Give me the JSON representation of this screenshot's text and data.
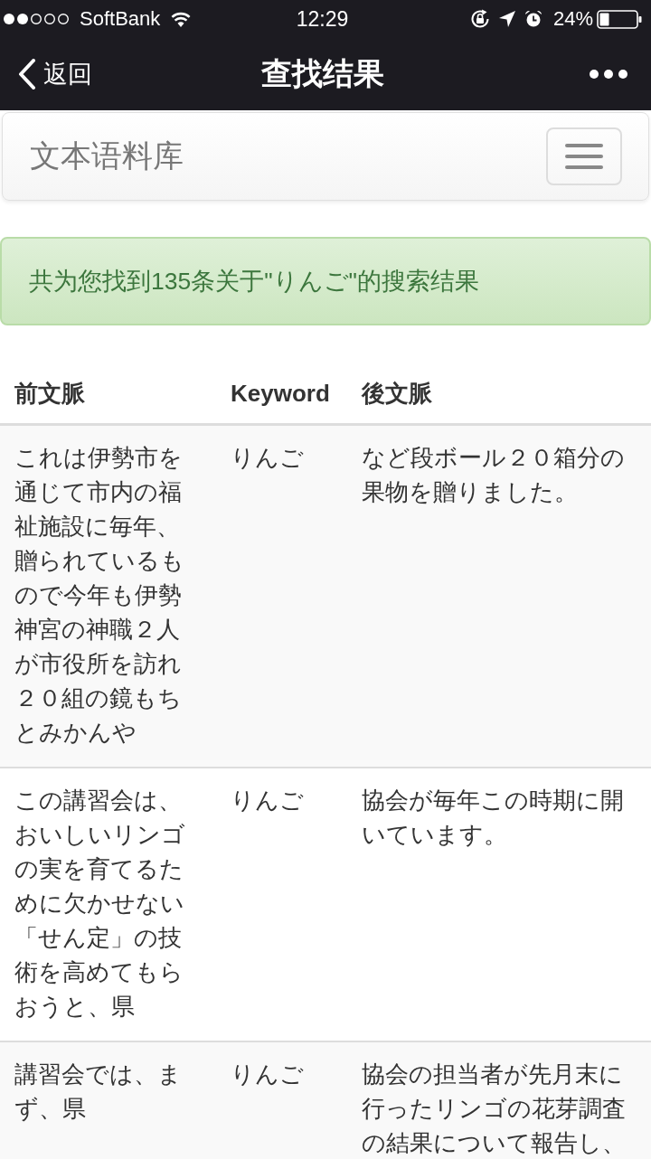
{
  "status_bar": {
    "carrier": "SoftBank",
    "time": "12:29",
    "battery": "24%"
  },
  "nav_bar": {
    "back_label": "返回",
    "title": "查找结果"
  },
  "brand_bar": {
    "brand": "文本语料库"
  },
  "alert": {
    "message": "共为您找到135条关于\"りんご\"的搜索结果"
  },
  "table": {
    "columns": [
      "前文脈",
      "Keyword",
      "後文脈"
    ],
    "rows": [
      {
        "before": "これは伊勢市を通じて市内の福祉施設に毎年、贈られているもので今年も伊勢神宮の神職２人が市役所を訪れ２０組の鏡もちとみかんや",
        "keyword": "りんご",
        "after": "など段ボール２０箱分の果物を贈りました。"
      },
      {
        "before": "この講習会は、おいしいリンゴの実を育てるために欠かせない「せん定」の技術を高めてもらおうと、県",
        "keyword": "りんご",
        "after": "協会が毎年この時期に開いています。"
      },
      {
        "before": "講習会では、まず、県",
        "keyword": "りんご",
        "after": "協会の担当者が先月末に行ったリンゴの花芽調査の結果について報告し、"
      }
    ]
  }
}
